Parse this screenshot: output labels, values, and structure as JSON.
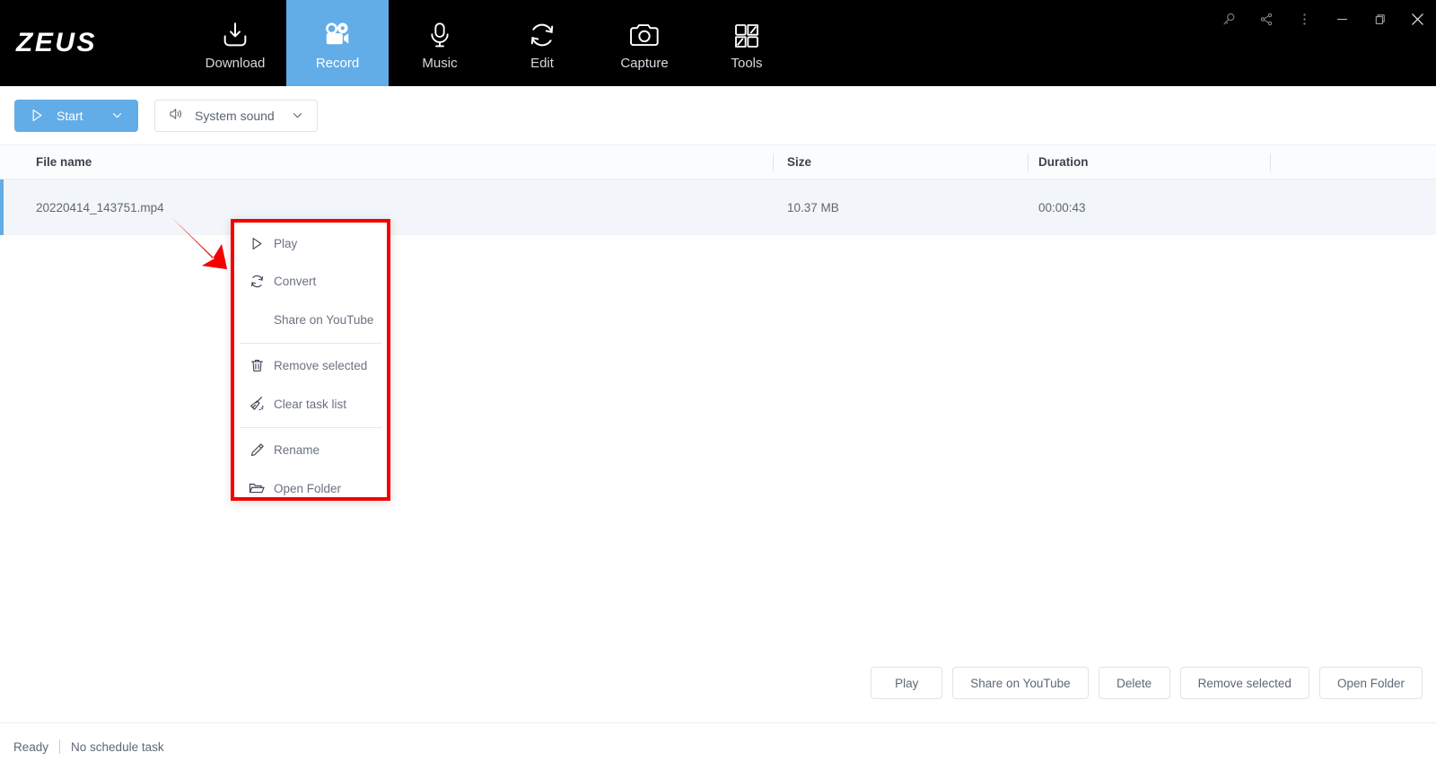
{
  "app": {
    "logo": "ZEUS",
    "accent_color": "#62ade8",
    "topbar_bg": "#000000",
    "annotation_color": "#f40000"
  },
  "nav": {
    "items": [
      {
        "label": "Download",
        "icon": "download-icon",
        "active": false
      },
      {
        "label": "Record",
        "icon": "video-camera-icon",
        "active": true
      },
      {
        "label": "Music",
        "icon": "microphone-icon",
        "active": false
      },
      {
        "label": "Edit",
        "icon": "refresh-edit-icon",
        "active": false
      },
      {
        "label": "Capture",
        "icon": "camera-icon",
        "active": false
      },
      {
        "label": "Tools",
        "icon": "grid-tools-icon",
        "active": false
      }
    ]
  },
  "window_controls": [
    {
      "name": "key-search-icon"
    },
    {
      "name": "share-nodes-icon"
    },
    {
      "name": "more-vertical-icon"
    },
    {
      "name": "minimize-icon"
    },
    {
      "name": "maximize-icon"
    },
    {
      "name": "close-icon"
    }
  ],
  "toolbar": {
    "start_label": "Start",
    "start_icon": "play-icon",
    "start_caret_icon": "chevron-down-icon",
    "sound_label": "System sound",
    "sound_icon": "speaker-icon",
    "sound_caret_icon": "chevron-down-icon"
  },
  "table": {
    "columns": [
      "File name",
      "Size",
      "Duration",
      ""
    ],
    "rows": [
      {
        "file_name": "20220414_143751.mp4",
        "size": "10.37 MB",
        "duration": "00:00:43",
        "selected": true
      }
    ]
  },
  "context_menu": {
    "groups": [
      {
        "items": [
          {
            "label": "Play",
            "icon": "play-icon"
          },
          {
            "label": "Convert",
            "icon": "convert-icon"
          },
          {
            "label": "Share on YouTube",
            "icon": ""
          }
        ]
      },
      {
        "items": [
          {
            "label": "Remove selected",
            "icon": "trash-icon"
          },
          {
            "label": "Clear task list",
            "icon": "broom-icon"
          }
        ]
      },
      {
        "items": [
          {
            "label": "Rename",
            "icon": "pencil-icon"
          },
          {
            "label": "Open Folder",
            "icon": "folder-icon"
          }
        ]
      }
    ]
  },
  "bottom_buttons": [
    {
      "label": "Play"
    },
    {
      "label": "Share on YouTube"
    },
    {
      "label": "Delete"
    },
    {
      "label": "Remove selected"
    },
    {
      "label": "Open Folder"
    }
  ],
  "status_bar": {
    "state": "Ready",
    "schedule": "No schedule task"
  }
}
